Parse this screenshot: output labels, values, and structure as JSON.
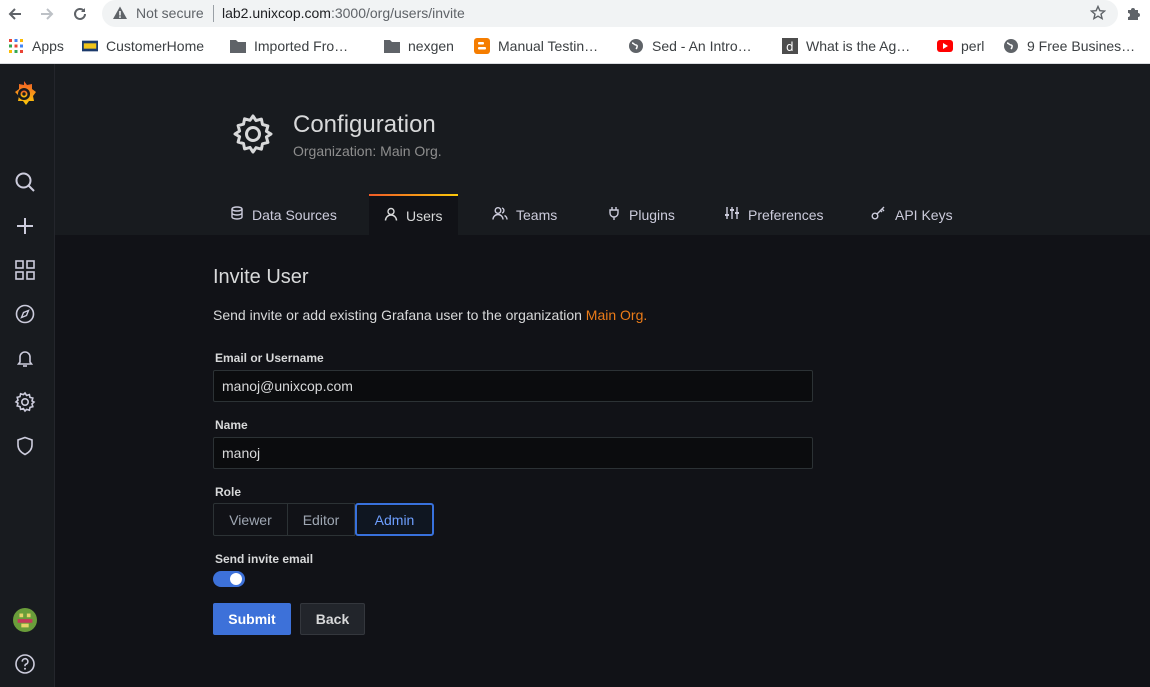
{
  "browser": {
    "security_label": "Not secure",
    "url_host": "lab2.unixcop.com",
    "url_path": ":3000/org/users/invite",
    "bookmarks": [
      {
        "label": "Apps",
        "icon": "apps-grid-icon"
      },
      {
        "label": "CustomerHome",
        "icon": "customer-home-icon"
      },
      {
        "label": "Imported Fro…",
        "icon": "folder-icon"
      },
      {
        "label": "nexgen",
        "icon": "folder-icon"
      },
      {
        "label": "Manual Testin…",
        "icon": "blogger-icon"
      },
      {
        "label": "Sed - An Intro…",
        "icon": "globe-icon"
      },
      {
        "label": "What is the Ag…",
        "icon": "d-icon"
      },
      {
        "label": "perl",
        "icon": "youtube-icon"
      },
      {
        "label": "9 Free Busines…",
        "icon": "globe-icon"
      }
    ]
  },
  "header": {
    "title": "Configuration",
    "subtitle": "Organization: Main Org."
  },
  "tabs": [
    {
      "label": "Data Sources",
      "icon": "database-icon"
    },
    {
      "label": "Users",
      "icon": "user-icon",
      "active": true
    },
    {
      "label": "Teams",
      "icon": "users-icon"
    },
    {
      "label": "Plugins",
      "icon": "plug-icon"
    },
    {
      "label": "Preferences",
      "icon": "sliders-icon"
    },
    {
      "label": "API Keys",
      "icon": "key-icon"
    }
  ],
  "form": {
    "heading": "Invite User",
    "description": "Send invite or add existing Grafana user to the organization ",
    "org_name": "Main Org.",
    "email_label": "Email or Username",
    "email_value": "manoj@unixcop.com",
    "name_label": "Name",
    "name_value": "manoj",
    "role_label": "Role",
    "roles": [
      "Viewer",
      "Editor",
      "Admin"
    ],
    "selected_role": "Admin",
    "send_invite_label": "Send invite email",
    "send_invite_enabled": true,
    "submit_label": "Submit",
    "back_label": "Back"
  },
  "colors": {
    "accent_blue": "#3d71d9",
    "org_link": "#eb7b18",
    "tab_gradient_start": "#f05a28",
    "tab_gradient_end": "#fbca0a"
  }
}
